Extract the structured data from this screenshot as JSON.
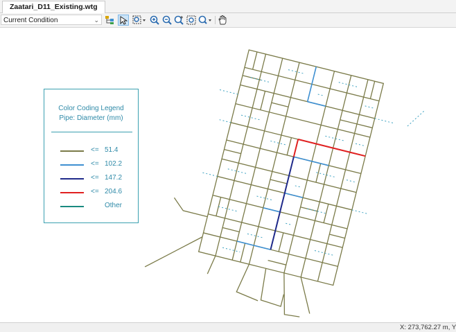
{
  "tab": {
    "label": "Zaatari_D11_Existing.wtg"
  },
  "toolbar": {
    "scenario_value": "Current Condition",
    "icons": [
      "network-tree-icon",
      "select-pointer-icon",
      "zoom-extents-icon",
      "zoom-in-icon",
      "zoom-out-icon",
      "zoom-realtime-icon",
      "zoom-window-icon",
      "zoom-previous-icon",
      "pan-hand-icon"
    ]
  },
  "legend": {
    "title_line1": "Color Coding Legend",
    "title_line2": "Pipe: Diameter (mm)",
    "items": [
      {
        "op": "<=",
        "value": "51.4",
        "color": "#7a7a48"
      },
      {
        "op": "<=",
        "value": "102.2",
        "color": "#3d8fd1"
      },
      {
        "op": "<=",
        "value": "147.2",
        "color": "#1f2a8a"
      },
      {
        "op": "<=",
        "value": "204.6",
        "color": "#e02020"
      },
      {
        "op": "",
        "value": "Other",
        "color": "#1a8a80"
      }
    ]
  },
  "colors": {
    "pipe_small": "#7a7a48",
    "pipe_102": "#3d8fd1",
    "pipe_147": "#1f2a8a",
    "pipe_204": "#e02020",
    "node_dots": "#3aa0c0"
  },
  "statusbar": {
    "coordinate": "X: 273,762.27 m, Y"
  }
}
